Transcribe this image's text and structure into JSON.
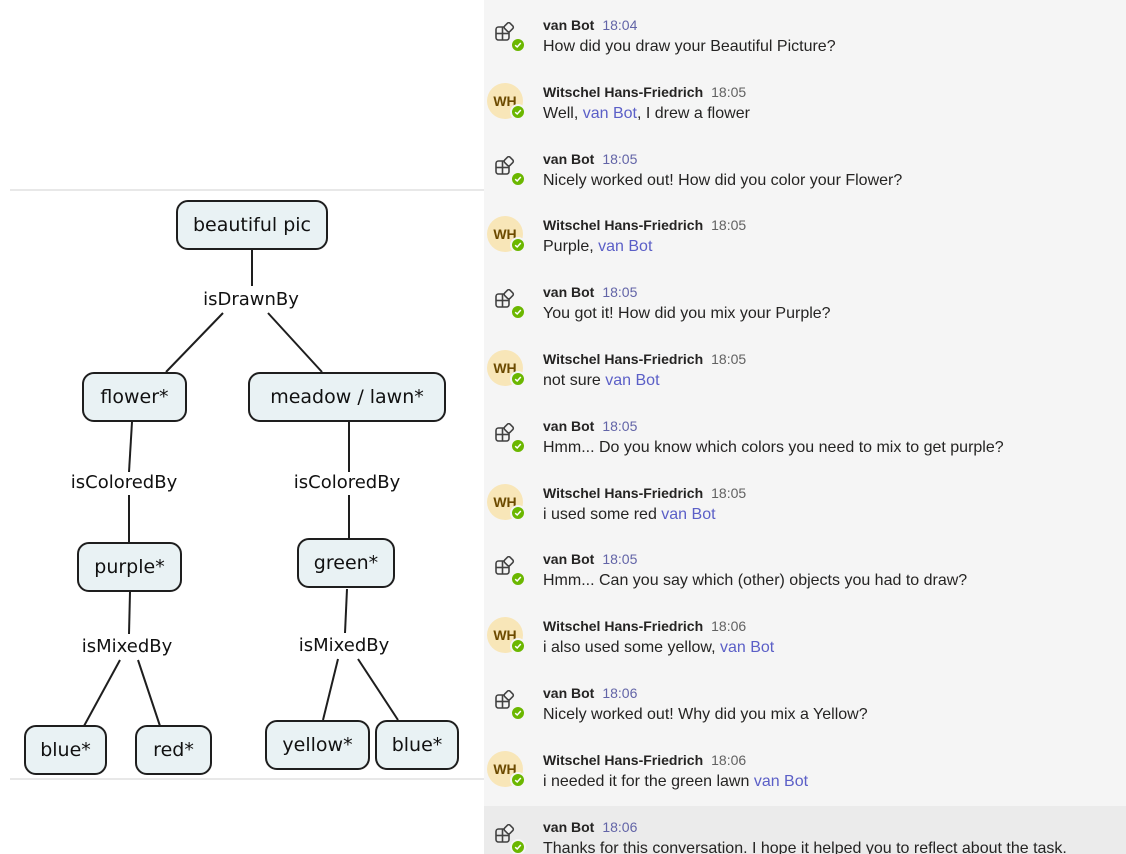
{
  "diagram": {
    "nodes": {
      "root": "beautiful pic",
      "flower": "flower*",
      "meadow": "meadow / lawn*",
      "purple": "purple*",
      "green": "green*",
      "blue1": "blue*",
      "red": "red*",
      "yellow": "yellow*",
      "blue2": "blue*"
    },
    "relations": {
      "drawn": "isDrawnBy",
      "colored1": "isColoredBy",
      "colored2": "isColoredBy",
      "mixed1": "isMixedBy",
      "mixed2": "isMixedBy"
    }
  },
  "chat": {
    "messages": [
      {
        "sender": "van Bot",
        "time": "18:04",
        "avatar": "bot-icon",
        "pre": "How did you draw your Beautiful Picture?",
        "mention": "",
        "post": ""
      },
      {
        "sender": "Witschel Hans-Friedrich",
        "time": "18:05",
        "avatar": "WH",
        "pre": "Well, ",
        "mention": "van Bot",
        "post": ", I drew a flower"
      },
      {
        "sender": "van Bot",
        "time": "18:05",
        "avatar": "bot-icon",
        "pre": "Nicely worked out! How did you color your Flower?",
        "mention": "",
        "post": ""
      },
      {
        "sender": "Witschel Hans-Friedrich",
        "time": "18:05",
        "avatar": "WH",
        "pre": "Purple, ",
        "mention": "van Bot",
        "post": ""
      },
      {
        "sender": "van Bot",
        "time": "18:05",
        "avatar": "bot-icon",
        "pre": "You got it! How did you mix your Purple?",
        "mention": "",
        "post": ""
      },
      {
        "sender": "Witschel Hans-Friedrich",
        "time": "18:05",
        "avatar": "WH",
        "pre": "not sure ",
        "mention": "van Bot",
        "post": ""
      },
      {
        "sender": "van Bot",
        "time": "18:05",
        "avatar": "bot-icon",
        "pre": "Hmm... Do you know which colors you need to mix to get purple?",
        "mention": "",
        "post": ""
      },
      {
        "sender": "Witschel Hans-Friedrich",
        "time": "18:05",
        "avatar": "WH",
        "pre": "i used some red ",
        "mention": "van Bot",
        "post": ""
      },
      {
        "sender": "van Bot",
        "time": "18:05",
        "avatar": "bot-icon",
        "pre": "Hmm... Can you say which (other) objects you had to draw?",
        "mention": "",
        "post": ""
      },
      {
        "sender": "Witschel Hans-Friedrich",
        "time": "18:06",
        "avatar": "WH",
        "pre": "i also used some yellow, ",
        "mention": "van Bot",
        "post": ""
      },
      {
        "sender": "van Bot",
        "time": "18:06",
        "avatar": "bot-icon",
        "pre": "Nicely worked out! Why did you mix a Yellow?",
        "mention": "",
        "post": ""
      },
      {
        "sender": "Witschel Hans-Friedrich",
        "time": "18:06",
        "avatar": "WH",
        "pre": "i needed it for the green lawn ",
        "mention": "van Bot",
        "post": ""
      },
      {
        "sender": "van Bot",
        "time": "18:06",
        "avatar": "bot-icon",
        "pre": "Thanks for this conversation. I hope it helped you to reflect about the task.",
        "mention": "",
        "post": ""
      }
    ]
  },
  "colors": {
    "node_fill": "#e9f2f4",
    "mention": "#5b5fc7",
    "bot_time": "#6264a7",
    "presence": "#6bb700",
    "user_avatar_bg": "#f8e6b8"
  }
}
